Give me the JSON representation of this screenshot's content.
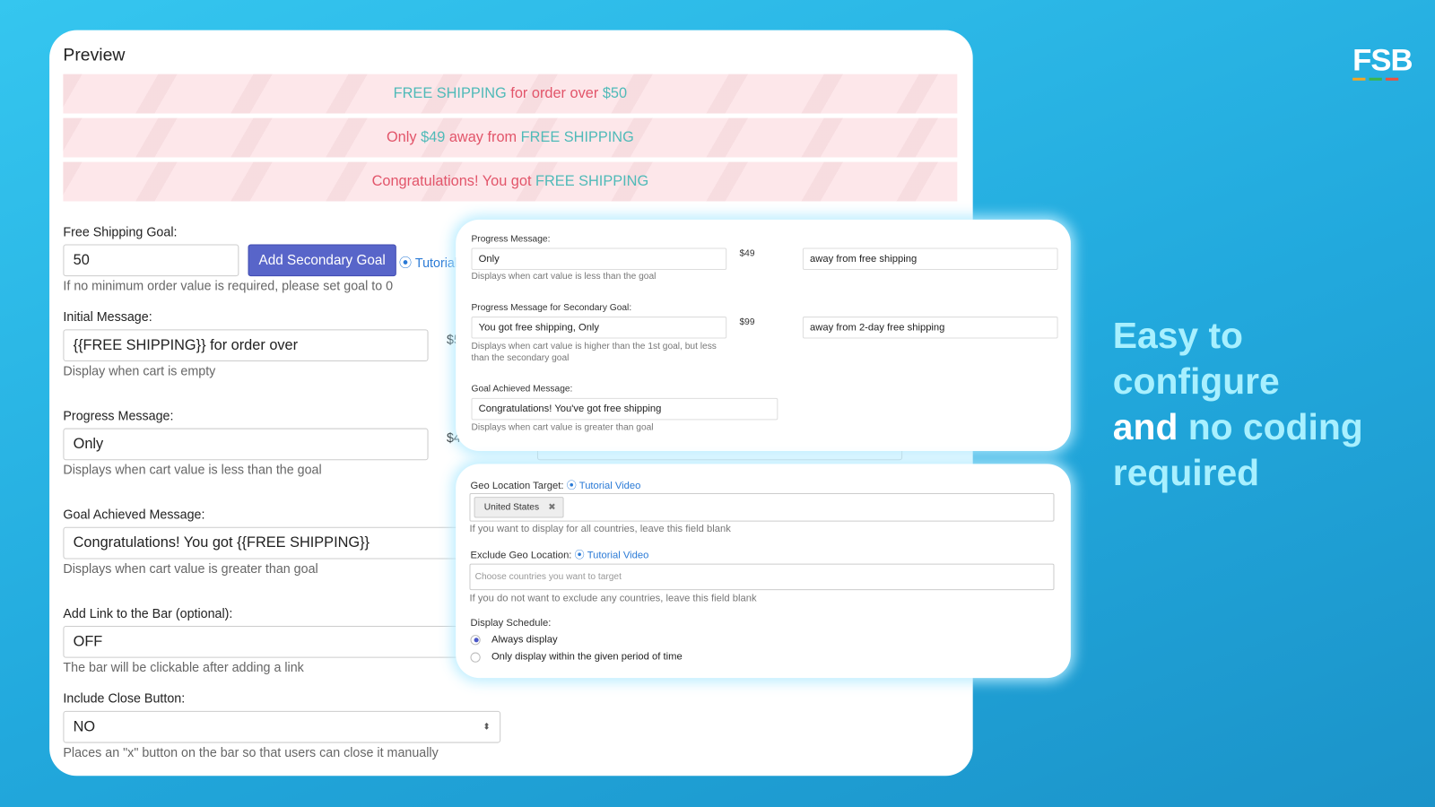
{
  "logo": {
    "text": "FSB",
    "stripe_colors": [
      "#f5a623",
      "#3bb54a",
      "#f0503c"
    ]
  },
  "headline": {
    "line1": "Easy to",
    "line2": "configure",
    "line3a": "and ",
    "line3b": "no coding",
    "line4": "required"
  },
  "preview": {
    "title": "Preview",
    "bars": [
      {
        "parts": [
          {
            "t": "FREE SHIPPING",
            "teal": true
          },
          {
            "t": " for order over "
          },
          {
            "t": "$50",
            "teal": true
          }
        ]
      },
      {
        "parts": [
          {
            "t": "Only "
          },
          {
            "t": "$49",
            "teal": true
          },
          {
            "t": " away from "
          },
          {
            "t": "FREE SHIPPING",
            "teal": true
          }
        ]
      },
      {
        "parts": [
          {
            "t": "Congratulations! You got "
          },
          {
            "t": "FREE SHIPPING",
            "teal": true
          }
        ]
      }
    ],
    "bar_colors": {
      "background": "#fde7ea",
      "text": "#e2556a",
      "accent": "#4fbab8"
    }
  },
  "form": {
    "goal_label": "Free Shipping Goal:",
    "goal_value": "50",
    "add_secondary": "Add Secondary Goal",
    "tutorial": "Tutorial Video",
    "goal_help": "If no minimum order value is required, please set goal to 0",
    "initial_label": "Initial Message:",
    "initial_value": "{{FREE SHIPPING}} for order over",
    "initial_amount": "$50",
    "initial_help": "Display when cart is empty",
    "progress_label": "Progress Message:",
    "progress_value": "Only",
    "progress_amount": "$49",
    "progress_help": "Displays when cart value is less than the goal",
    "achieved_label": "Goal Achieved Message:",
    "achieved_value": "Congratulations! You got {{FREE SHIPPING}}",
    "achieved_help": "Displays when cart value is greater than goal",
    "link_label": "Add Link to the Bar (optional):",
    "link_value": "OFF",
    "link_help": "The bar will be clickable after adding a link",
    "close_label": "Include Close Button:",
    "close_value": "NO",
    "close_help": "Places an \"x\" button on the bar so that users can close it manually"
  },
  "card1": {
    "progress_label": "Progress Message:",
    "progress_value": "Only",
    "progress_amount": "$49",
    "progress_suffix": "away from free shipping",
    "progress_help": "Displays when cart value is less than the goal",
    "secondary_label": "Progress Message for Secondary Goal:",
    "secondary_value": "You got free shipping, Only",
    "secondary_amount": "$99",
    "secondary_suffix": "away from 2-day free shipping",
    "secondary_help": "Displays when cart value is higher than the 1st goal, but less than the secondary goal",
    "achieved_label": "Goal Achieved Message:",
    "achieved_value": "Congratulations! You've got free shipping",
    "achieved_help": "Displays when cart value is greater than goal"
  },
  "card2": {
    "geo_label": "Geo Location Target:",
    "geo_tutorial": "Tutorial Video",
    "geo_tag": "United States",
    "geo_help": "If you want to display for all countries, leave this field blank",
    "exclude_label": "Exclude Geo Location:",
    "exclude_tutorial": "Tutorial Video",
    "exclude_placeholder": "Choose countries you want to target",
    "exclude_help": "If you do not want to exclude any countries, leave this field blank",
    "schedule_label": "Display Schedule:",
    "schedule_options": [
      {
        "label": "Always display",
        "selected": true
      },
      {
        "label": "Only display within the given period of time",
        "selected": false
      }
    ]
  }
}
